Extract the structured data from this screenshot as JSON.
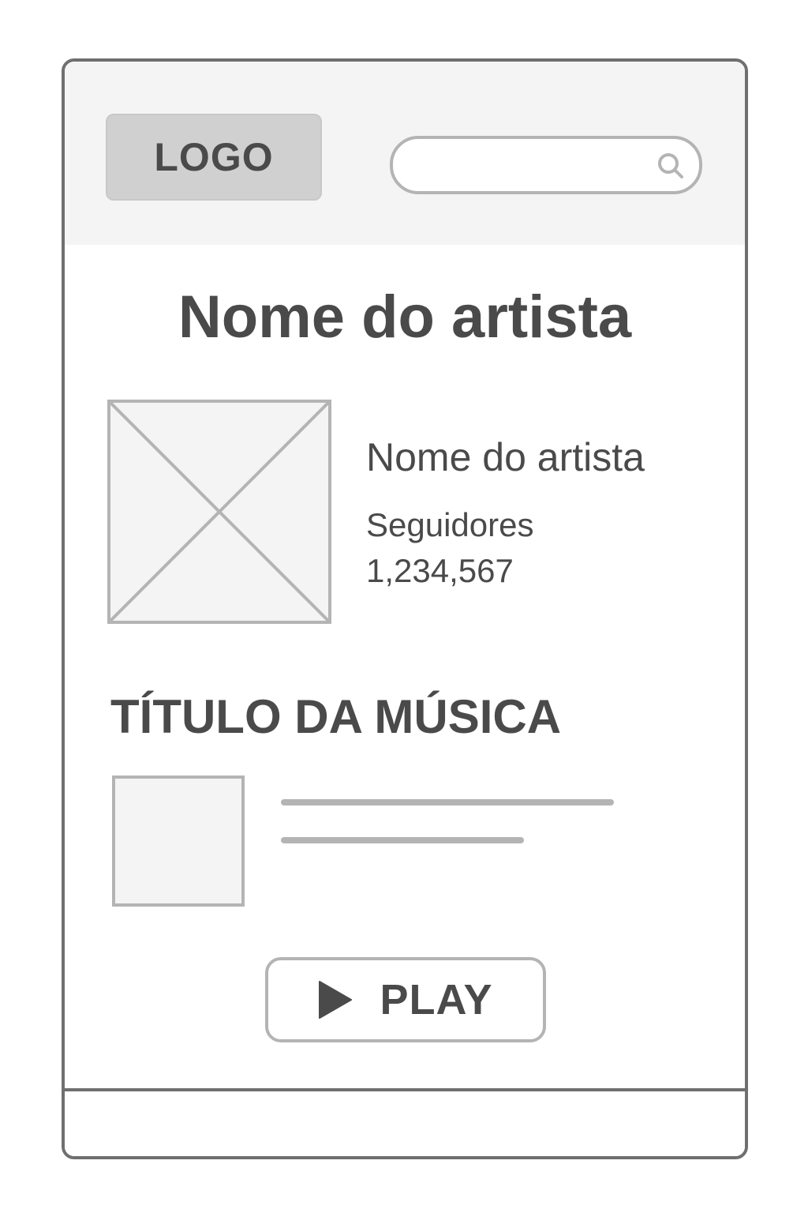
{
  "header": {
    "logo_label": "LOGO",
    "search": {
      "value": "",
      "placeholder": ""
    },
    "search_icon": "search-icon"
  },
  "main": {
    "page_title": "Nome do artista",
    "artist": {
      "image_icon": "image-placeholder-icon",
      "name": "Nome do artista",
      "followers_label": "Seguidores",
      "followers_count": "1,234,567"
    },
    "song": {
      "heading": "TÍTULO DA MÚSICA",
      "thumbnail_icon": "image-placeholder-icon"
    },
    "play_button": {
      "icon": "play-icon",
      "label": "PLAY"
    }
  },
  "colors": {
    "frame": "#6f6f6f",
    "header_bg": "#f4f4f4",
    "logo_bg": "#d0d0d0",
    "placeholder_stroke": "#b4b4b4",
    "text": "#4a4a4a"
  }
}
